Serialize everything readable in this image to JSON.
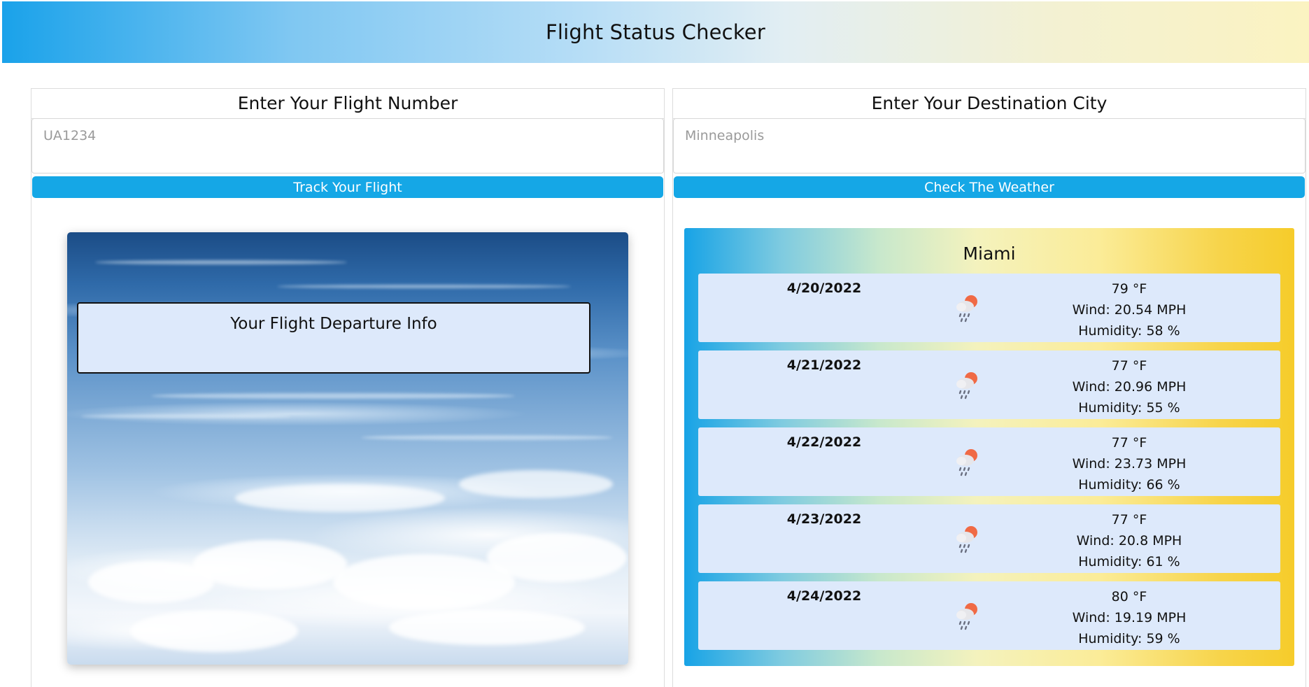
{
  "header": {
    "title": "Flight Status Checker"
  },
  "flight_panel": {
    "title": "Enter Your Flight Number",
    "input_placeholder": "UA1234",
    "button_label": "Track Your Flight",
    "departure_info_label": "Your Flight Departure Info"
  },
  "weather_panel": {
    "title": "Enter Your Destination City",
    "input_placeholder": "Minneapolis",
    "button_label": "Check The Weather",
    "city": "Miami",
    "days": [
      {
        "date": "4/20/2022",
        "icon": "rain-cloud-sun-icon",
        "temp": "79 °F",
        "wind": "Wind: 20.54 MPH",
        "humidity": "Humidity: 58 %"
      },
      {
        "date": "4/21/2022",
        "icon": "rain-cloud-sun-icon",
        "temp": "77 °F",
        "wind": "Wind: 20.96 MPH",
        "humidity": "Humidity: 55 %"
      },
      {
        "date": "4/22/2022",
        "icon": "rain-cloud-sun-icon",
        "temp": "77 °F",
        "wind": "Wind: 23.73 MPH",
        "humidity": "Humidity: 66 %"
      },
      {
        "date": "4/23/2022",
        "icon": "rain-cloud-sun-icon",
        "temp": "77 °F",
        "wind": "Wind: 20.8 MPH",
        "humidity": "Humidity: 61 %"
      },
      {
        "date": "4/24/2022",
        "icon": "rain-cloud-sun-icon",
        "temp": "80 °F",
        "wind": "Wind: 19.19 MPH",
        "humidity": "Humidity: 59 %"
      }
    ]
  },
  "colors": {
    "accent_button": "#15a7e6",
    "card_background": "#dde9fb",
    "header_gradient_start": "#1aa2ea",
    "header_gradient_end": "#fbf3c1",
    "weather_gradient_start": "#17a3e6",
    "weather_gradient_end": "#f6cc2a"
  }
}
